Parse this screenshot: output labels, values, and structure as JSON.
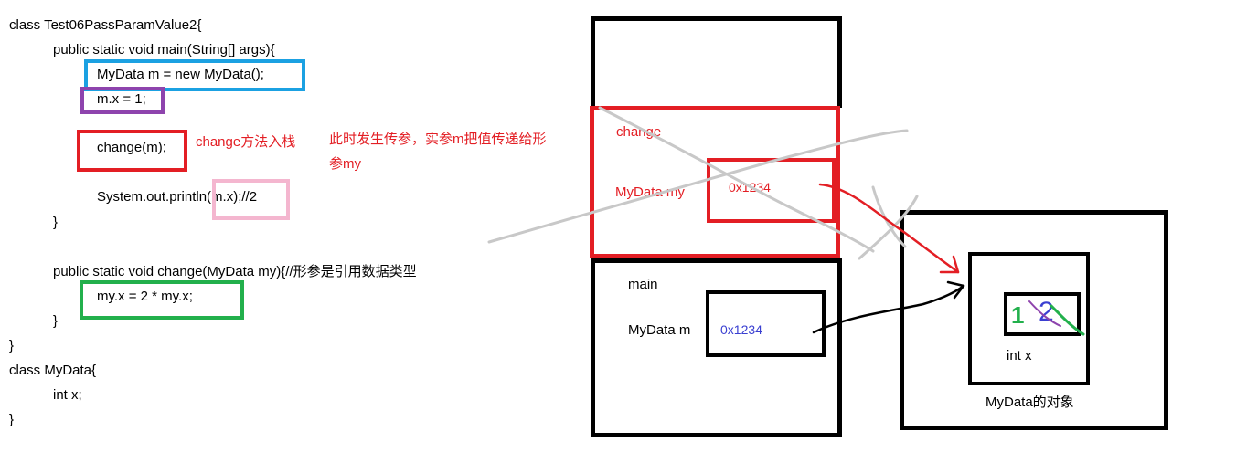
{
  "code": {
    "lines": [
      "class Test06PassParamValue2{",
      "public static void main(String[] args){",
      "MyData m = new MyData();",
      "m.x = 1;",
      "change(m);",
      "System.out.println(m.x);//2",
      "}",
      "public static void change(MyData my){//形参是引用数据类型",
      "my.x = 2 * my.x;",
      "}",
      "}",
      "class MyData{",
      "int x;",
      "}"
    ]
  },
  "annotations": {
    "change_push": "change方法入栈",
    "pass_param_line1": "此时发生传参，实参m把值传递给形",
    "pass_param_line2": "参my"
  },
  "stack": {
    "change_frame": {
      "title": "change",
      "var_label": "MyData my",
      "var_value": "0x1234"
    },
    "main_frame": {
      "title": "main",
      "var_label": "MyData m",
      "var_value": "0x1234"
    }
  },
  "heap": {
    "field_label": "int x",
    "object_label": "MyData的对象",
    "old_value": "1",
    "new_value": "2"
  },
  "colors": {
    "blue_box": "#1ba1e2",
    "purple_box": "#8e44ad",
    "red": "#e31e24",
    "pink_box": "#f4b6cf",
    "green_box": "#22b04c",
    "address_blue": "#3a3fd1",
    "strike_gray": "#c8c8c8"
  }
}
